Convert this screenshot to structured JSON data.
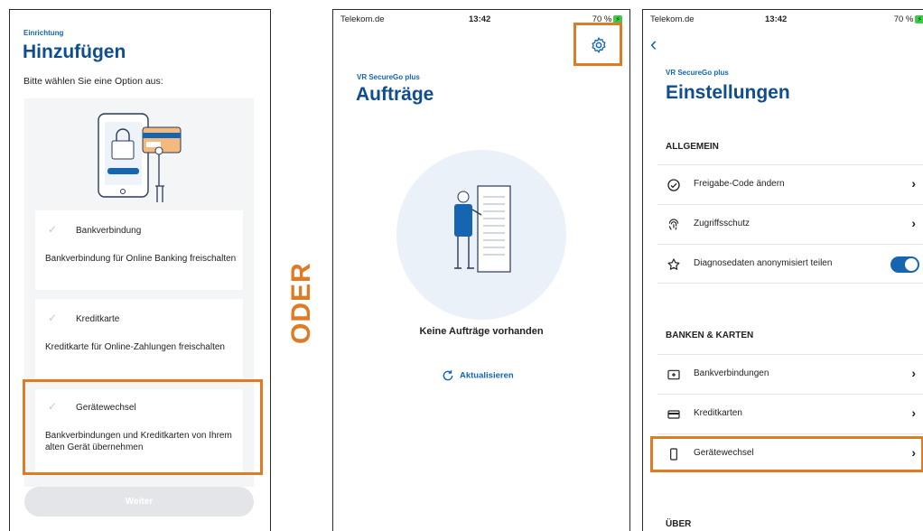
{
  "screen1": {
    "eyebrow": "Einrichtung",
    "title": "Hinzufügen",
    "subtitle": "Bitte wählen Sie eine Option aus:",
    "options": [
      {
        "title": "Bankverbindung",
        "description": "Bankverbindung für Online Banking freischalten"
      },
      {
        "title": "Kreditkarte",
        "description": "Kreditkarte für Online-Zahlungen freischalten"
      },
      {
        "title": "Gerätewechsel",
        "description": "Bankverbindungen und Kreditkarten von Ihrem alten Gerät übernehmen"
      }
    ],
    "button_label": "Weiter"
  },
  "separator_label": "ODER",
  "screen2": {
    "status": {
      "carrier": "Telekom.de",
      "time": "13:42",
      "battery": "70 %"
    },
    "eyebrow": "VR SecureGo plus",
    "title": "Aufträge",
    "empty_text": "Keine Aufträge vorhanden",
    "refresh_label": "Aktualisieren",
    "settings_icon": "gear-icon"
  },
  "screen3": {
    "status": {
      "carrier": "Telekom.de",
      "time": "13:42",
      "battery": "70 %"
    },
    "eyebrow": "VR SecureGo plus",
    "title": "Einstellungen",
    "sections": [
      {
        "header": "ALLGEMEIN",
        "items": [
          {
            "label": "Freigabe-Code ändern",
            "icon": "check-circle-icon"
          },
          {
            "label": "Zugriffsschutz",
            "icon": "fingerprint-icon"
          },
          {
            "label": "Diagnosedaten anonymisiert teilen",
            "icon": "star-icon",
            "toggle": true
          }
        ]
      },
      {
        "header": "BANKEN & KARTEN",
        "items": [
          {
            "label": "Bankverbindungen",
            "icon": "bank-icon"
          },
          {
            "label": "Kreditkarten",
            "icon": "credit-card-icon"
          },
          {
            "label": "Gerätewechsel",
            "icon": "phone-icon"
          }
        ]
      },
      {
        "header": "ÜBER",
        "items": []
      }
    ]
  },
  "colors": {
    "accent_orange": "#e07b25",
    "brand_blue": "#1565b0",
    "title_blue": "#0e4d8f"
  }
}
